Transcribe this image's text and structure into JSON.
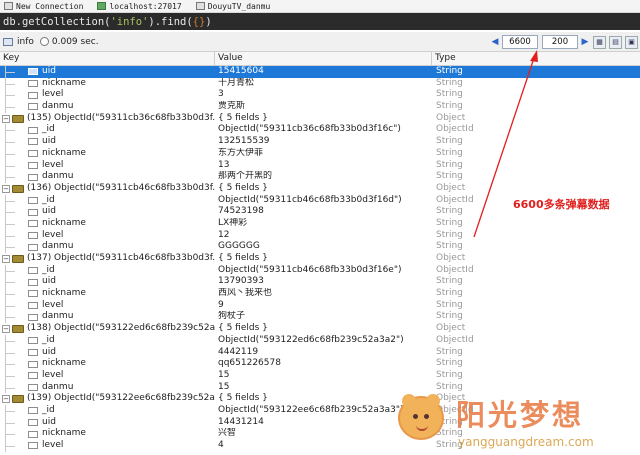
{
  "connection": {
    "name": "New Connection",
    "host": "localhost:27017",
    "database": "DouyuTV_danmu"
  },
  "query": {
    "prefix": "db.getCollection(",
    "collection_arg": "'info'",
    "middle": ").find(",
    "braces": "{}",
    "suffix": ")"
  },
  "result_bar": {
    "collection": "info",
    "time": "0.009 sec.",
    "skip": "6600",
    "limit": "200"
  },
  "columns": {
    "key": "Key",
    "value": "Value",
    "type": "Type"
  },
  "rows": [
    {
      "kind": "child",
      "key": "uid",
      "value": "15415604",
      "type": "String",
      "selected": true
    },
    {
      "kind": "child",
      "key": "nickname",
      "value": "十月青松",
      "type": "String"
    },
    {
      "kind": "child",
      "key": "level",
      "value": "3",
      "type": "String"
    },
    {
      "kind": "child",
      "key": "danmu",
      "value": "贾克斯",
      "type": "String"
    },
    {
      "kind": "top",
      "key": "(135) ObjectId(\"59311cb36c68fb33b0d3f...",
      "value": "{ 5 fields }",
      "type": "Object"
    },
    {
      "kind": "child",
      "key": "_id",
      "value": "ObjectId(\"59311cb36c68fb33b0d3f16c\")",
      "type": "ObjectId"
    },
    {
      "kind": "child",
      "key": "uid",
      "value": "132515539",
      "type": "String"
    },
    {
      "kind": "child",
      "key": "nickname",
      "value": "东方大伊菲",
      "type": "String"
    },
    {
      "kind": "child",
      "key": "level",
      "value": "13",
      "type": "String"
    },
    {
      "kind": "child",
      "key": "danmu",
      "value": "那两个开黑的",
      "type": "String"
    },
    {
      "kind": "top",
      "key": "(136) ObjectId(\"59311cb46c68fb33b0d3f...",
      "value": "{ 5 fields }",
      "type": "Object"
    },
    {
      "kind": "child",
      "key": "_id",
      "value": "ObjectId(\"59311cb46c68fb33b0d3f16d\")",
      "type": "ObjectId"
    },
    {
      "kind": "child",
      "key": "uid",
      "value": "74523198",
      "type": "String"
    },
    {
      "kind": "child",
      "key": "nickname",
      "value": "LX神彩",
      "type": "String"
    },
    {
      "kind": "child",
      "key": "level",
      "value": "12",
      "type": "String"
    },
    {
      "kind": "child",
      "key": "danmu",
      "value": "GGGGGG",
      "type": "String"
    },
    {
      "kind": "top",
      "key": "(137) ObjectId(\"59311cb46c68fb33b0d3f...",
      "value": "{ 5 fields }",
      "type": "Object"
    },
    {
      "kind": "child",
      "key": "_id",
      "value": "ObjectId(\"59311cb46c68fb33b0d3f16e\")",
      "type": "ObjectId"
    },
    {
      "kind": "child",
      "key": "uid",
      "value": "13790393",
      "type": "String"
    },
    {
      "kind": "child",
      "key": "nickname",
      "value": "西风丶我来也",
      "type": "String"
    },
    {
      "kind": "child",
      "key": "level",
      "value": "9",
      "type": "String"
    },
    {
      "kind": "child",
      "key": "danmu",
      "value": "狗杖子",
      "type": "String"
    },
    {
      "kind": "top",
      "key": "(138) ObjectId(\"593122ed6c68fb239c52a...",
      "value": "{ 5 fields }",
      "type": "Object"
    },
    {
      "kind": "child",
      "key": "_id",
      "value": "ObjectId(\"593122ed6c68fb239c52a3a2\")",
      "type": "ObjectId"
    },
    {
      "kind": "child",
      "key": "uid",
      "value": "4442119",
      "type": "String"
    },
    {
      "kind": "child",
      "key": "nickname",
      "value": "qq651226578",
      "type": "String"
    },
    {
      "kind": "child",
      "key": "level",
      "value": "15",
      "type": "String"
    },
    {
      "kind": "child",
      "key": "danmu",
      "value": "15",
      "type": "String"
    },
    {
      "kind": "top",
      "key": "(139) ObjectId(\"593122ee6c68fb239c52a...",
      "value": "{ 5 fields }",
      "type": "Object"
    },
    {
      "kind": "child",
      "key": "_id",
      "value": "ObjectId(\"593122ee6c68fb239c52a3a3\")",
      "type": "ObjectId"
    },
    {
      "kind": "child",
      "key": "uid",
      "value": "14431214",
      "type": "String"
    },
    {
      "kind": "child",
      "key": "nickname",
      "value": "兴智",
      "type": "String"
    },
    {
      "kind": "child",
      "key": "level",
      "value": "4",
      "type": "String"
    }
  ],
  "annotation": {
    "text": "6600多条弹幕数据",
    "color": "#e0201e"
  },
  "watermark": {
    "title": "阳光梦想",
    "url": "yangguangdream.com"
  }
}
